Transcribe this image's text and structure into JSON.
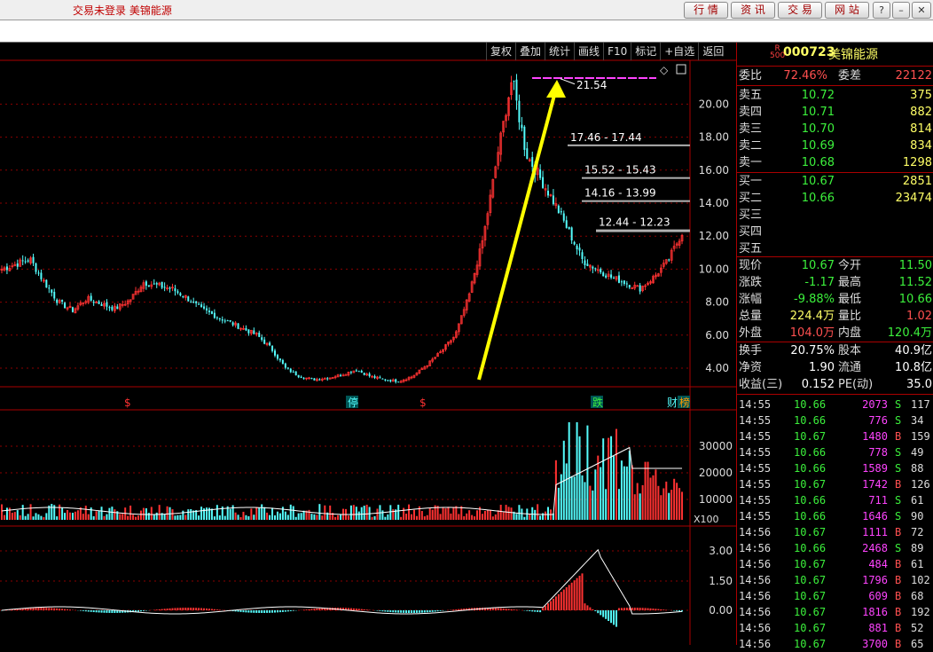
{
  "top": {
    "status": "交易未登录  美锦能源",
    "buttons": [
      "行 情",
      "资 讯",
      "交 易",
      "网 站"
    ],
    "win": [
      "?",
      "–",
      "▭",
      "✕"
    ]
  },
  "toolbar": [
    "复权",
    "叠加",
    "统计",
    "画线",
    "F10",
    "标记",
    "+自选",
    "返回"
  ],
  "chart": {
    "price_labels": [
      "20.00",
      "18.00",
      "16.00",
      "14.00",
      "12.00",
      "10.00",
      "8.00",
      "6.00",
      "4.00"
    ],
    "vol_labels": [
      "30000",
      "20000",
      "10000",
      "X100"
    ],
    "macd_labels": [
      "3.00",
      "1.50",
      "0.00"
    ],
    "high_label": "21.54",
    "zones": [
      "17.46 - 17.44",
      "15.52 - 15.43",
      "14.16 - 13.99",
      "12.44 - 12.23"
    ],
    "markers": [
      "$",
      "停",
      "$",
      "跌",
      "财",
      "榜"
    ],
    "colors": {
      "up": "#ff3232",
      "down": "#54fcfc",
      "arrow": "#ffff00",
      "grid": "#8b0000",
      "magenta": "#ff44ff"
    }
  },
  "chart_data": {
    "type": "candlestick",
    "price_axis": [
      4,
      20
    ],
    "high": 21.54,
    "low": 3.1,
    "approx_close_path": [
      10.0,
      10.3,
      10.6,
      9.2,
      8.0,
      7.5,
      8.2,
      7.9,
      7.6,
      8.1,
      9.2,
      9.0,
      8.8,
      8.3,
      7.6,
      7.2,
      6.8,
      6.4,
      6.0,
      5.2,
      4.0,
      3.5,
      3.3,
      3.4,
      3.6,
      3.9,
      3.5,
      3.3,
      3.2,
      3.5,
      4.2,
      5.0,
      6.0,
      8.5,
      12.0,
      17.0,
      21.54,
      17.0,
      15.5,
      14.0,
      12.3,
      10.5,
      10.0,
      9.5,
      9.2,
      8.8,
      9.5,
      10.5,
      12.2
    ]
  },
  "panel": {
    "code_prefix": "R",
    "code_sub": "500",
    "code": "000723",
    "name": "美锦能源",
    "weibi": {
      "l1": "委比",
      "v1": "72.46%",
      "l2": "委差",
      "v2": "22122"
    },
    "sells": [
      {
        "label": "卖五",
        "price": "10.72",
        "vol": "375"
      },
      {
        "label": "卖四",
        "price": "10.71",
        "vol": "882"
      },
      {
        "label": "卖三",
        "price": "10.70",
        "vol": "814"
      },
      {
        "label": "卖二",
        "price": "10.69",
        "vol": "834"
      },
      {
        "label": "卖一",
        "price": "10.68",
        "vol": "1298"
      }
    ],
    "buys": [
      {
        "label": "买一",
        "price": "10.67",
        "vol": "2851"
      },
      {
        "label": "买二",
        "price": "10.66",
        "vol": "23474"
      },
      {
        "label": "买三",
        "price": "",
        "vol": ""
      },
      {
        "label": "买四",
        "price": "",
        "vol": ""
      },
      {
        "label": "买五",
        "price": "",
        "vol": ""
      }
    ],
    "quotes": [
      {
        "l1": "现价",
        "v1": "10.67",
        "c1": "#3cf03c",
        "l2": "今开",
        "v2": "11.50",
        "c2": "#3cf03c"
      },
      {
        "l1": "涨跌",
        "v1": "-1.17",
        "c1": "#3cf03c",
        "l2": "最高",
        "v2": "11.52",
        "c2": "#3cf03c"
      },
      {
        "l1": "涨幅",
        "v1": "-9.88%",
        "c1": "#3cf03c",
        "l2": "最低",
        "v2": "10.66",
        "c2": "#3cf03c"
      },
      {
        "l1": "总量",
        "v1": "224.4万",
        "c1": "#ffff66",
        "l2": "量比",
        "v2": "1.02",
        "c2": "#ff5050"
      },
      {
        "l1": "外盘",
        "v1": "104.0万",
        "c1": "#ff5050",
        "l2": "内盘",
        "v2": "120.4万",
        "c2": "#3cf03c"
      }
    ],
    "fund": [
      {
        "l1": "换手",
        "v1": "20.75%",
        "l2": "股本",
        "v2": "40.9亿"
      },
      {
        "l1": "净资",
        "v1": "1.90",
        "l2": "流通",
        "v2": "10.8亿"
      },
      {
        "l1": "收益(三)",
        "v1": "0.152",
        "l2": "PE(动)",
        "v2": "35.0"
      }
    ],
    "ticks": [
      {
        "t": "14:55",
        "p": "10.66",
        "v": "2073",
        "d": "S",
        "n": "117"
      },
      {
        "t": "14:55",
        "p": "10.66",
        "v": "776",
        "d": "S",
        "n": "34"
      },
      {
        "t": "14:55",
        "p": "10.67",
        "v": "1480",
        "d": "B",
        "n": "159"
      },
      {
        "t": "14:55",
        "p": "10.66",
        "v": "778",
        "d": "S",
        "n": "49"
      },
      {
        "t": "14:55",
        "p": "10.66",
        "v": "1589",
        "d": "S",
        "n": "88"
      },
      {
        "t": "14:55",
        "p": "10.67",
        "v": "1742",
        "d": "B",
        "n": "126"
      },
      {
        "t": "14:55",
        "p": "10.66",
        "v": "711",
        "d": "S",
        "n": "61"
      },
      {
        "t": "14:55",
        "p": "10.66",
        "v": "1646",
        "d": "S",
        "n": "90"
      },
      {
        "t": "14:56",
        "p": "10.67",
        "v": "1111",
        "d": "B",
        "n": "72"
      },
      {
        "t": "14:56",
        "p": "10.66",
        "v": "2468",
        "d": "S",
        "n": "89"
      },
      {
        "t": "14:56",
        "p": "10.67",
        "v": "484",
        "d": "B",
        "n": "61"
      },
      {
        "t": "14:56",
        "p": "10.67",
        "v": "1796",
        "d": "B",
        "n": "102"
      },
      {
        "t": "14:56",
        "p": "10.67",
        "v": "609",
        "d": "B",
        "n": "68"
      },
      {
        "t": "14:56",
        "p": "10.67",
        "v": "1816",
        "d": "B",
        "n": "192"
      },
      {
        "t": "14:56",
        "p": "10.67",
        "v": "881",
        "d": "B",
        "n": "52"
      },
      {
        "t": "14:56",
        "p": "10.67",
        "v": "3700",
        "d": "B",
        "n": "65"
      }
    ]
  }
}
